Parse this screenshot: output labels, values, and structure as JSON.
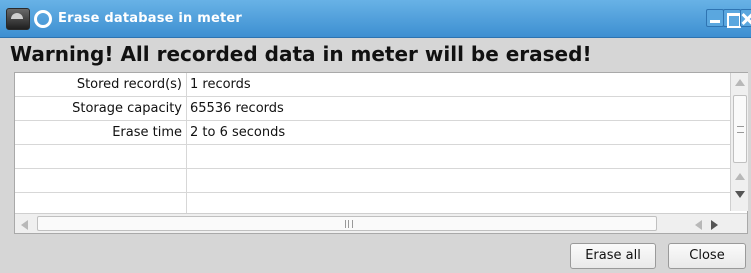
{
  "window": {
    "title": "Erase database in meter"
  },
  "warning": "Warning! All recorded data in meter will be erased!",
  "table": {
    "rows": [
      {
        "label": "Stored record(s)",
        "value": "1 records"
      },
      {
        "label": "Storage capacity",
        "value": "65536 records"
      },
      {
        "label": "Erase time",
        "value": "2 to 6 seconds"
      },
      {
        "label": "",
        "value": ""
      },
      {
        "label": "",
        "value": ""
      },
      {
        "label": "",
        "value": ""
      }
    ]
  },
  "buttons": {
    "erase_all": "Erase all",
    "close": "Close"
  },
  "colors": {
    "titlebar": "#4a9bd8",
    "title_text": "#ffffff",
    "background": "#d6d6d6"
  }
}
